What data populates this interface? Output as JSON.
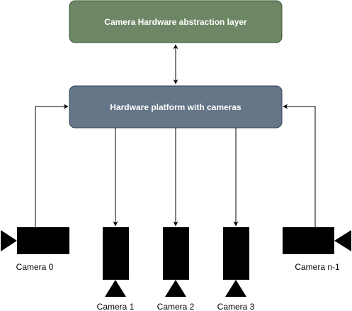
{
  "nodes": {
    "hal": {
      "label": "Camera Hardware abstraction layer",
      "fill": "#6d8764",
      "stroke": "#3a5431"
    },
    "platform": {
      "label": "Hardware platform with cameras",
      "fill": "#647687",
      "stroke": "#314354"
    }
  },
  "cameras": [
    {
      "label": "Camera 0"
    },
    {
      "label": "Camera 1"
    },
    {
      "label": "Camera 2"
    },
    {
      "label": "Camera 3"
    },
    {
      "label": "Camera n-1"
    }
  ],
  "colors": {
    "camera": "#000000",
    "edge": "#000000",
    "background": "#ffffff"
  }
}
